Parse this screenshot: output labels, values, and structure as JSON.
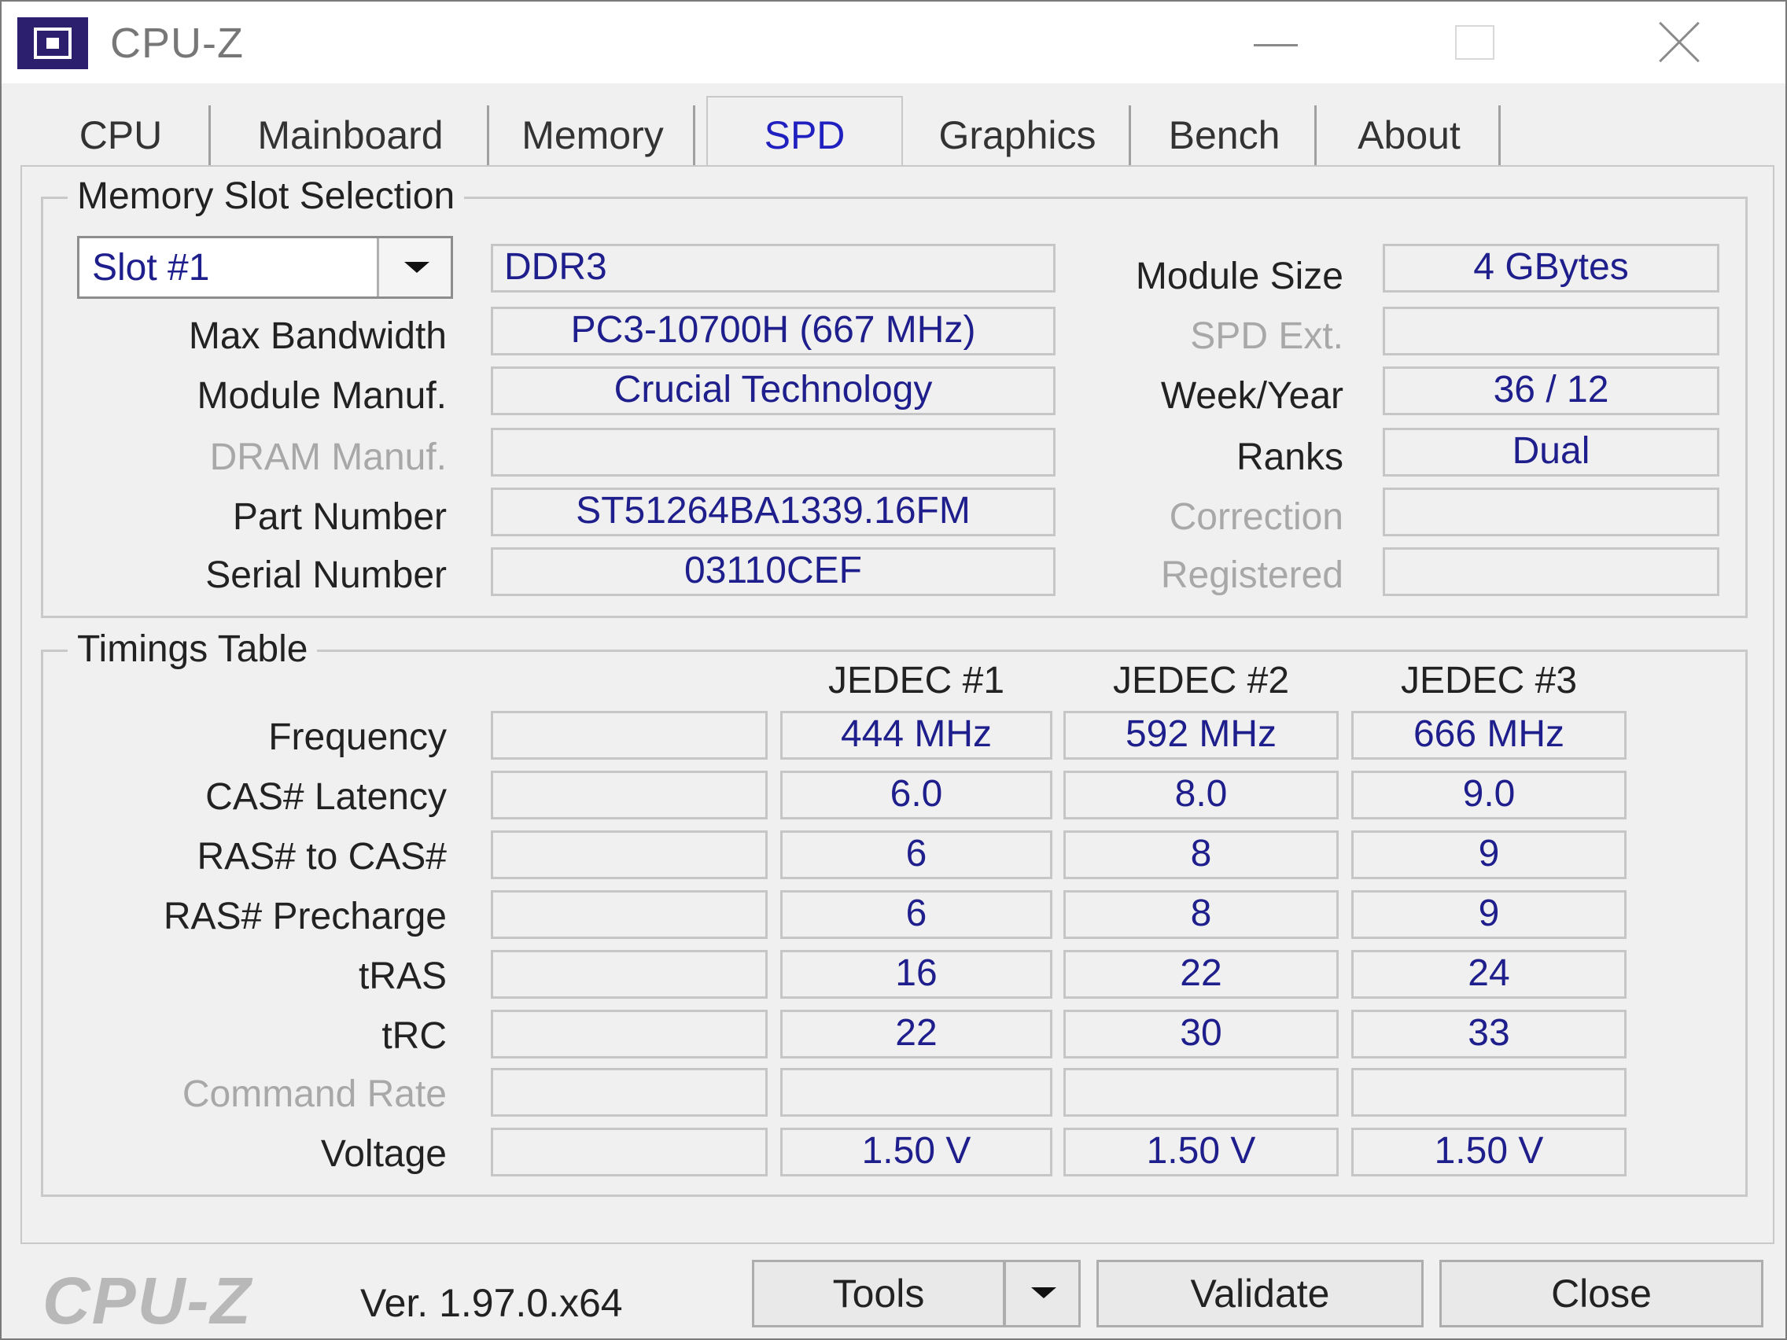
{
  "window": {
    "title": "CPU-Z"
  },
  "tabs": [
    {
      "label": "CPU"
    },
    {
      "label": "Mainboard"
    },
    {
      "label": "Memory"
    },
    {
      "label": "SPD",
      "active": true
    },
    {
      "label": "Graphics"
    },
    {
      "label": "Bench"
    },
    {
      "label": "About"
    }
  ],
  "slot_selection": {
    "title": "Memory Slot Selection",
    "slot": "Slot #1",
    "memory_type": "DDR3",
    "labels": {
      "max_bandwidth": "Max Bandwidth",
      "module_manuf": "Module Manuf.",
      "dram_manuf": "DRAM Manuf.",
      "part_number": "Part Number",
      "serial_number": "Serial Number",
      "module_size": "Module Size",
      "spd_ext": "SPD Ext.",
      "week_year": "Week/Year",
      "ranks": "Ranks",
      "correction": "Correction",
      "registered": "Registered"
    },
    "values": {
      "max_bandwidth": "PC3-10700H (667 MHz)",
      "module_manuf": "Crucial Technology",
      "dram_manuf": "",
      "part_number": "ST51264BA1339.16FM",
      "serial_number": "03110CEF",
      "module_size": "4 GBytes",
      "spd_ext": "",
      "week_year": "36 / 12",
      "ranks": "Dual",
      "correction": "",
      "registered": ""
    }
  },
  "timings": {
    "title": "Timings Table",
    "columns": [
      "JEDEC #1",
      "JEDEC #2",
      "JEDEC #3"
    ],
    "rows": [
      {
        "label": "Frequency",
        "values": [
          "",
          "444 MHz",
          "592 MHz",
          "666 MHz"
        ]
      },
      {
        "label": "CAS# Latency",
        "values": [
          "",
          "6.0",
          "8.0",
          "9.0"
        ]
      },
      {
        "label": "RAS# to CAS#",
        "values": [
          "",
          "6",
          "8",
          "9"
        ]
      },
      {
        "label": "RAS# Precharge",
        "values": [
          "",
          "6",
          "8",
          "9"
        ]
      },
      {
        "label": "tRAS",
        "values": [
          "",
          "16",
          "22",
          "24"
        ]
      },
      {
        "label": "tRC",
        "values": [
          "",
          "22",
          "30",
          "33"
        ]
      },
      {
        "label": "Command Rate",
        "values": [
          "",
          "",
          "",
          ""
        ],
        "disabled": true
      },
      {
        "label": "Voltage",
        "values": [
          "",
          "1.50 V",
          "1.50 V",
          "1.50 V"
        ]
      }
    ]
  },
  "footer": {
    "logo": "CPU-Z",
    "version": "Ver. 1.97.0.x64",
    "tools_label": "Tools",
    "validate_label": "Validate",
    "close_label": "Close"
  }
}
